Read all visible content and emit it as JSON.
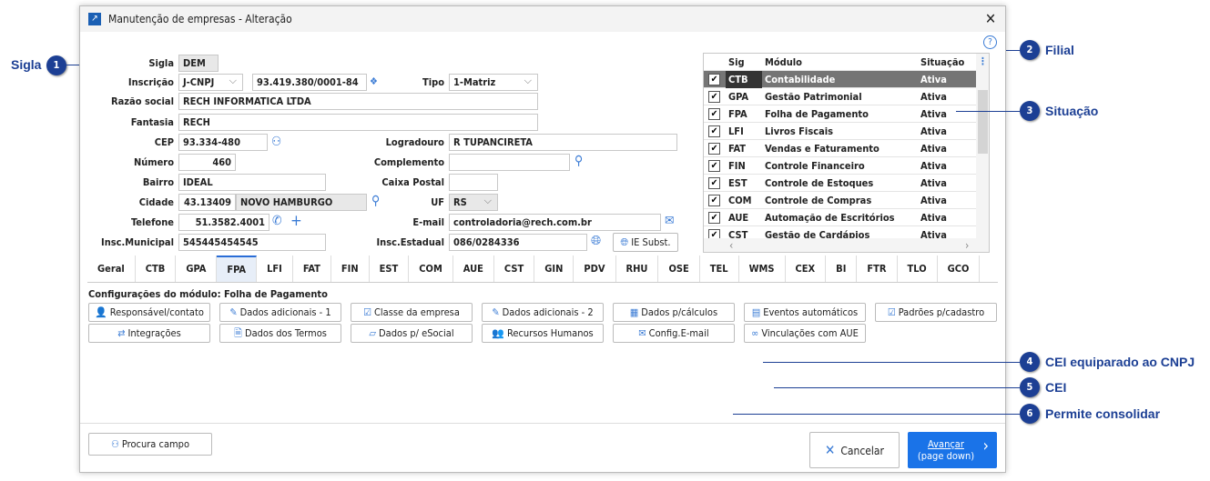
{
  "window": {
    "title": "Manutenção de empresas - Alteração",
    "help": "?",
    "close": "✕"
  },
  "form": {
    "sigla": {
      "label": "Sigla",
      "value": "DEM"
    },
    "inscricao": {
      "label": "Inscrição",
      "type": "J-CNPJ",
      "number": "93.419.380/0001-84"
    },
    "tipo": {
      "label": "Tipo",
      "value": "1-Matriz"
    },
    "razao": {
      "label": "Razão social",
      "value": "RECH INFORMATICA LTDA"
    },
    "fantasia": {
      "label": "Fantasia",
      "value": "RECH"
    },
    "cep": {
      "label": "CEP",
      "value": "93.334-480"
    },
    "logradouro": {
      "label": "Logradouro",
      "value": "R TUPANCIRETA"
    },
    "numero": {
      "label": "Número",
      "value": "460"
    },
    "complemento": {
      "label": "Complemento",
      "value": ""
    },
    "bairro": {
      "label": "Bairro",
      "value": "IDEAL"
    },
    "caixa": {
      "label": "Caixa Postal",
      "value": ""
    },
    "cidade": {
      "label": "Cidade",
      "code": "43.13409",
      "name": "NOVO HAMBURGO"
    },
    "uf": {
      "label": "UF",
      "value": "RS"
    },
    "telefone": {
      "label": "Telefone",
      "value": "51.3582.4001"
    },
    "email": {
      "label": "E-mail",
      "value": "controladoria@rech.com.br"
    },
    "im": {
      "label": "Insc.Municipal",
      "value": "545445454545"
    },
    "ie": {
      "label": "Insc.Estadual",
      "value": "086/0284336"
    },
    "ie_subst": "IE Subst."
  },
  "grid": {
    "headers": [
      "Sig",
      "Módulo",
      "Situação"
    ],
    "rows": [
      {
        "sig": "CTB",
        "mod": "Contabilidade",
        "sit": "Ativa"
      },
      {
        "sig": "GPA",
        "mod": "Gestão Patrimonial",
        "sit": "Ativa"
      },
      {
        "sig": "FPA",
        "mod": "Folha de Pagamento",
        "sit": "Ativa"
      },
      {
        "sig": "LFI",
        "mod": "Livros Fiscais",
        "sit": "Ativa"
      },
      {
        "sig": "FAT",
        "mod": "Vendas e Faturamento",
        "sit": "Ativa"
      },
      {
        "sig": "FIN",
        "mod": "Controle Financeiro",
        "sit": "Ativa"
      },
      {
        "sig": "EST",
        "mod": "Controle de Estoques",
        "sit": "Ativa"
      },
      {
        "sig": "COM",
        "mod": "Controle de Compras",
        "sit": "Ativa"
      },
      {
        "sig": "AUE",
        "mod": "Automação de Escritórios",
        "sit": "Ativa"
      },
      {
        "sig": "CST",
        "mod": "Gestão de Cardápios",
        "sit": "Ativa"
      }
    ]
  },
  "tabs": [
    "Geral",
    "CTB",
    "GPA",
    "FPA",
    "LFI",
    "FAT",
    "FIN",
    "EST",
    "COM",
    "AUE",
    "CST",
    "GIN",
    "PDV",
    "RHU",
    "OSE",
    "TEL",
    "WMS",
    "CEX",
    "BI",
    "FTR",
    "TLO",
    "GCO"
  ],
  "active_tab": "FPA",
  "config_title": "Configurações do módulo: Folha de Pagamento",
  "config_buttons": [
    {
      "label": "Responsável/contato",
      "icon": "👤"
    },
    {
      "label": "Dados adicionais - 1",
      "icon": "✎"
    },
    {
      "label": "Classe da empresa",
      "icon": "☑"
    },
    {
      "label": "Dados adicionais - 2",
      "icon": "✎"
    },
    {
      "label": "Dados p/cálculos",
      "icon": "▦"
    },
    {
      "label": "Eventos automáticos",
      "icon": "▤"
    },
    {
      "label": "Padrões p/cadastro",
      "icon": "☑"
    },
    {
      "label": "Integrações",
      "icon": "⇄"
    },
    {
      "label": "Dados dos Termos",
      "icon": "🗎"
    },
    {
      "label": "Dados p/ eSocial",
      "icon": "▱"
    },
    {
      "label": "Recursos Humanos",
      "icon": "👥"
    },
    {
      "label": "Config.E-mail",
      "icon": "✉"
    },
    {
      "label": "Vinculações com AUE",
      "icon": "∞"
    }
  ],
  "footer": {
    "procura": "Procura campo",
    "cancelar": "Cancelar",
    "avancar": "Avançar",
    "avancar_sub": "(page down)"
  },
  "callouts": [
    {
      "n": "1",
      "text": "Sigla"
    },
    {
      "n": "2",
      "text": "Filial"
    },
    {
      "n": "3",
      "text": "Situação"
    },
    {
      "n": "4",
      "text": "CEI equiparado ao CNPJ"
    },
    {
      "n": "5",
      "text": "CEI"
    },
    {
      "n": "6",
      "text": "Permite consolidar"
    }
  ]
}
